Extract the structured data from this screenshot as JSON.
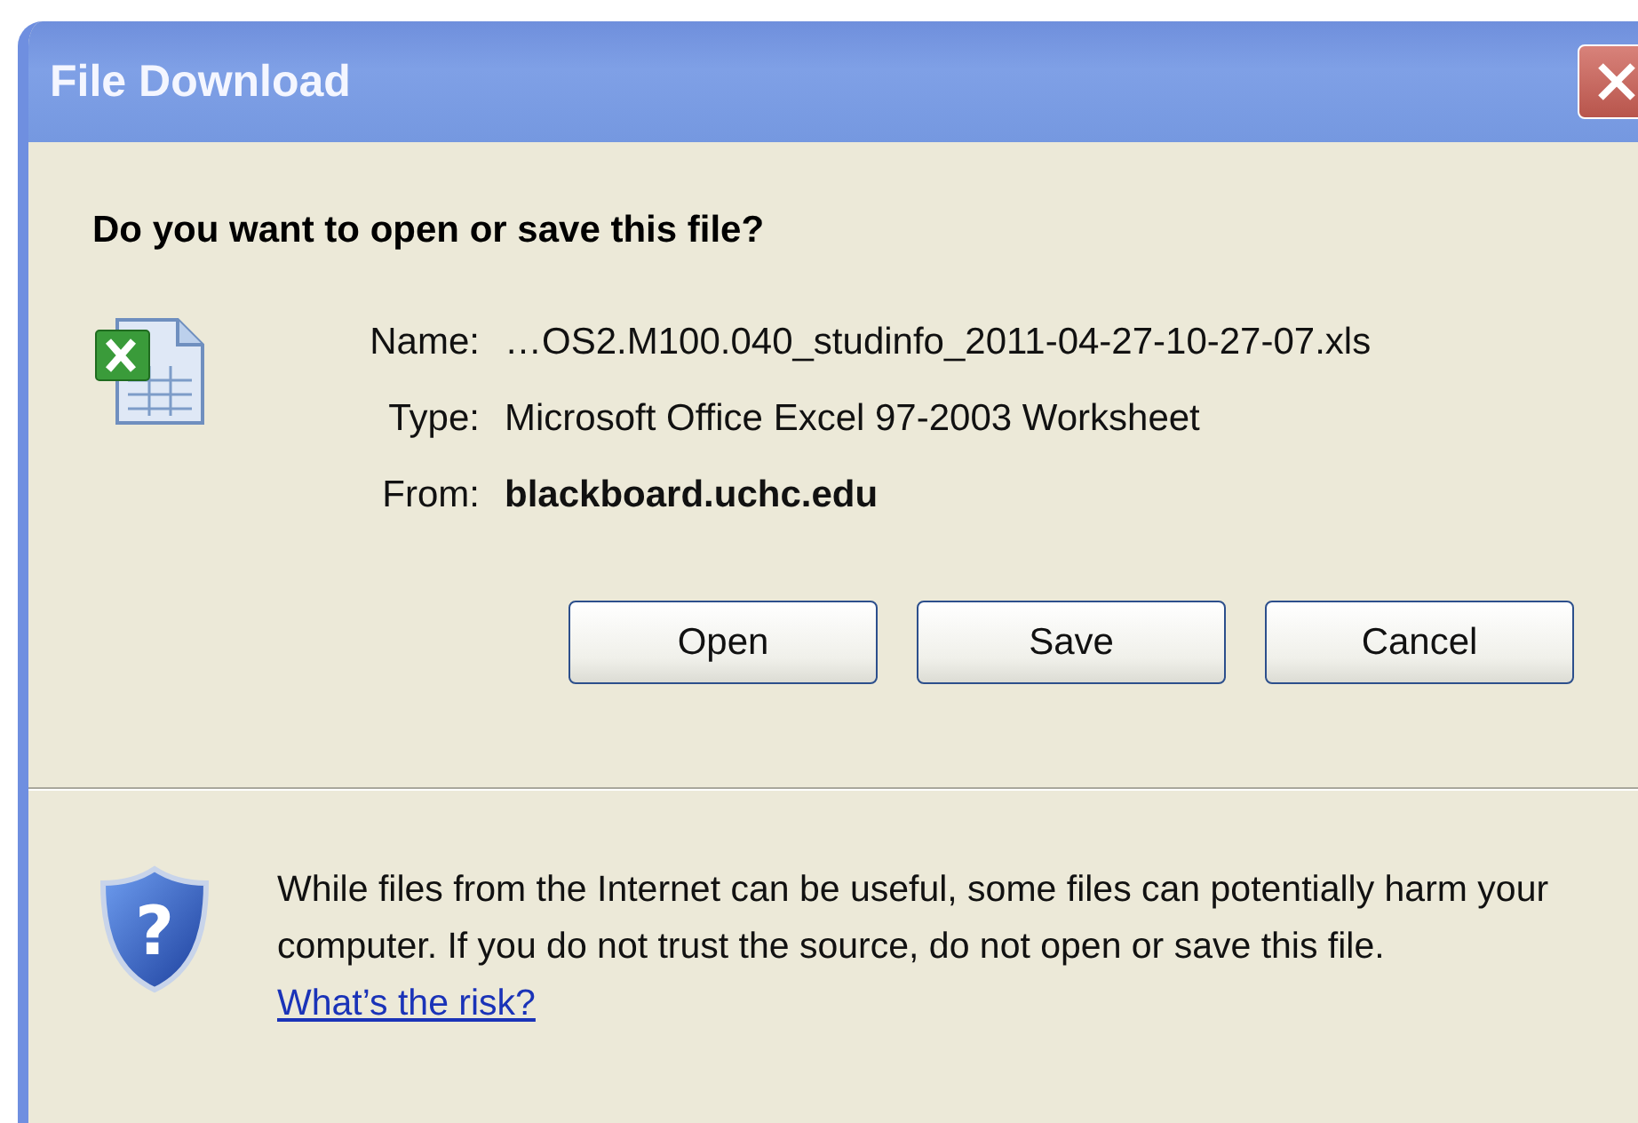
{
  "window": {
    "title": "File Download"
  },
  "question": "Do you want to open or save this file?",
  "file": [
    {
      "label": "Name:",
      "value": "…OS2.M100.040_studinfo_2011-04-27-10-27-07.xls",
      "kind": "plain"
    },
    {
      "label": "Type:",
      "value": "Microsoft Office Excel 97-2003 Worksheet",
      "kind": "plain"
    },
    {
      "label": "From:",
      "value": "blackboard.uchc.edu",
      "kind": "strong"
    }
  ],
  "buttons": [
    "Open",
    "Save",
    "Cancel"
  ],
  "warning": {
    "icon_glyph": "?",
    "text": "While files from the Internet can be useful, some files can potentially harm your computer. If you do not trust the source, do not open or save this file.",
    "link": "What’s the risk?"
  }
}
